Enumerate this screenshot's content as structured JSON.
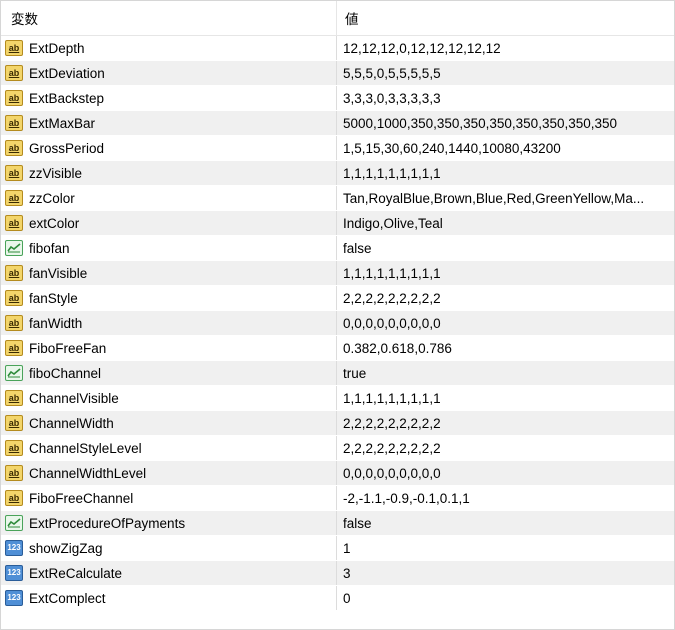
{
  "header": {
    "col_name": "変数",
    "col_value": "値"
  },
  "rows": [
    {
      "icon": "ab-icon",
      "type": "ab",
      "name": "ExtDepth",
      "value": "12,12,12,0,12,12,12,12,12"
    },
    {
      "icon": "ab-icon",
      "type": "ab",
      "name": "ExtDeviation",
      "value": "5,5,5,0,5,5,5,5,5"
    },
    {
      "icon": "ab-icon",
      "type": "ab",
      "name": "ExtBackstep",
      "value": "3,3,3,0,3,3,3,3,3"
    },
    {
      "icon": "ab-icon",
      "type": "ab",
      "name": "ExtMaxBar",
      "value": "5000,1000,350,350,350,350,350,350,350,350"
    },
    {
      "icon": "ab-icon",
      "type": "ab",
      "name": "GrossPeriod",
      "value": "1,5,15,30,60,240,1440,10080,43200"
    },
    {
      "icon": "ab-icon",
      "type": "ab",
      "name": "zzVisible",
      "value": "1,1,1,1,1,1,1,1,1"
    },
    {
      "icon": "ab-icon",
      "type": "ab",
      "name": "zzColor",
      "value": "Tan,RoyalBlue,Brown,Blue,Red,GreenYellow,Ma..."
    },
    {
      "icon": "ab-icon",
      "type": "ab",
      "name": "extColor",
      "value": "Indigo,Olive,Teal"
    },
    {
      "icon": "bool-icon",
      "type": "bool",
      "name": "fibofan",
      "value": "false"
    },
    {
      "icon": "ab-icon",
      "type": "ab",
      "name": "fanVisible",
      "value": "1,1,1,1,1,1,1,1,1"
    },
    {
      "icon": "ab-icon",
      "type": "ab",
      "name": "fanStyle",
      "value": "2,2,2,2,2,2,2,2,2"
    },
    {
      "icon": "ab-icon",
      "type": "ab",
      "name": "fanWidth",
      "value": "0,0,0,0,0,0,0,0,0"
    },
    {
      "icon": "ab-icon",
      "type": "ab",
      "name": "FiboFreeFan",
      "value": "0.382,0.618,0.786"
    },
    {
      "icon": "bool-icon",
      "type": "bool",
      "name": "fiboChannel",
      "value": "true"
    },
    {
      "icon": "ab-icon",
      "type": "ab",
      "name": "ChannelVisible",
      "value": "1,1,1,1,1,1,1,1,1"
    },
    {
      "icon": "ab-icon",
      "type": "ab",
      "name": "ChannelWidth",
      "value": "2,2,2,2,2,2,2,2,2"
    },
    {
      "icon": "ab-icon",
      "type": "ab",
      "name": "ChannelStyleLevel",
      "value": "2,2,2,2,2,2,2,2,2"
    },
    {
      "icon": "ab-icon",
      "type": "ab",
      "name": "ChannelWidthLevel",
      "value": "0,0,0,0,0,0,0,0,0"
    },
    {
      "icon": "ab-icon",
      "type": "ab",
      "name": "FiboFreeChannel",
      "value": "-2,-1.1,-0.9,-0.1,0.1,1"
    },
    {
      "icon": "bool-icon",
      "type": "bool",
      "name": "ExtProcedureOfPayments",
      "value": "false"
    },
    {
      "icon": "int-icon",
      "type": "n123",
      "name": "showZigZag",
      "value": "1"
    },
    {
      "icon": "int-icon",
      "type": "n123",
      "name": "ExtReCalculate",
      "value": "3"
    },
    {
      "icon": "int-icon",
      "type": "n123",
      "name": "ExtComplect",
      "value": "0"
    }
  ],
  "icon_glyphs": {
    "ab": "ab",
    "n123": "123"
  },
  "colors": {
    "alt_row": "#f0f0f0",
    "ab_icon": "#f3d56a",
    "int_icon": "#4f8fd6",
    "bool_icon": "#4aa35a"
  }
}
